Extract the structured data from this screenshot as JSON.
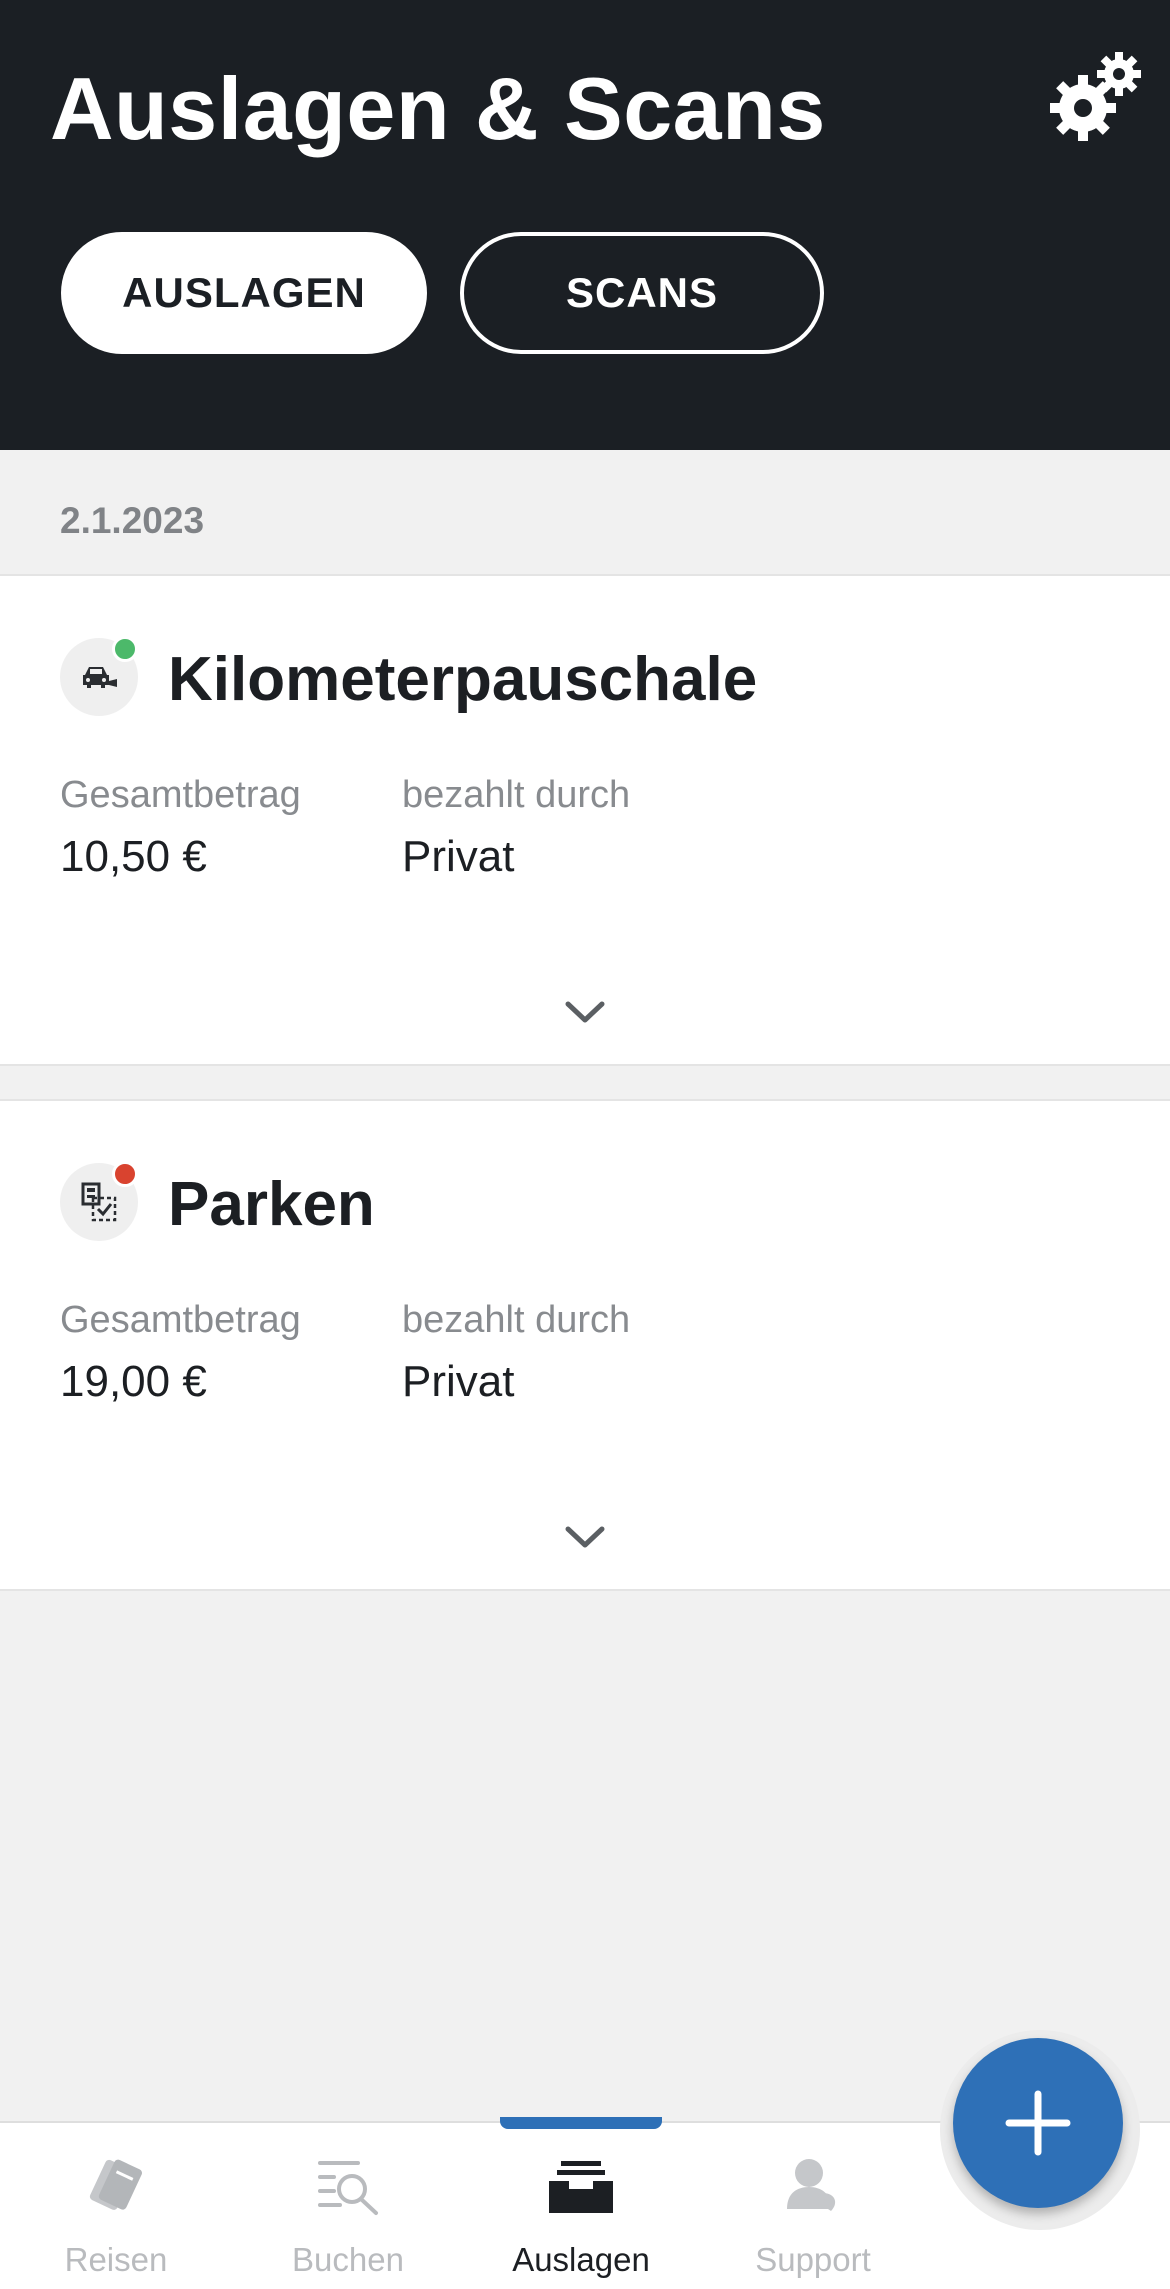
{
  "header": {
    "title": "Auslagen & Scans",
    "settings_icon": "gears-icon",
    "tabs": [
      {
        "label": "AUSLAGEN",
        "active": true
      },
      {
        "label": "SCANS",
        "active": false
      }
    ]
  },
  "list": {
    "date": "2.1.2023",
    "expenses": [
      {
        "title": "Kilometerpauschale",
        "icon": "car-mileage-icon",
        "status_color": "#4cb96a",
        "total_label": "Gesamtbetrag",
        "total_value": "10,50 €",
        "paid_by_label": "bezahlt durch",
        "paid_by_value": "Privat"
      },
      {
        "title": "Parken",
        "icon": "parking-receipt-icon",
        "status_color": "#d9432f",
        "total_label": "Gesamtbetrag",
        "total_value": "19,00 €",
        "paid_by_label": "bezahlt durch",
        "paid_by_value": "Privat"
      }
    ]
  },
  "fab": {
    "icon": "plus-icon"
  },
  "nav": {
    "accent": "#2e70b7",
    "items": [
      {
        "label": "Reisen",
        "icon": "tickets-icon",
        "active": false
      },
      {
        "label": "Buchen",
        "icon": "search-list-icon",
        "active": false
      },
      {
        "label": "Auslagen",
        "icon": "inbox-tray-icon",
        "active": true
      },
      {
        "label": "Support",
        "icon": "support-person-icon",
        "active": false
      }
    ]
  }
}
